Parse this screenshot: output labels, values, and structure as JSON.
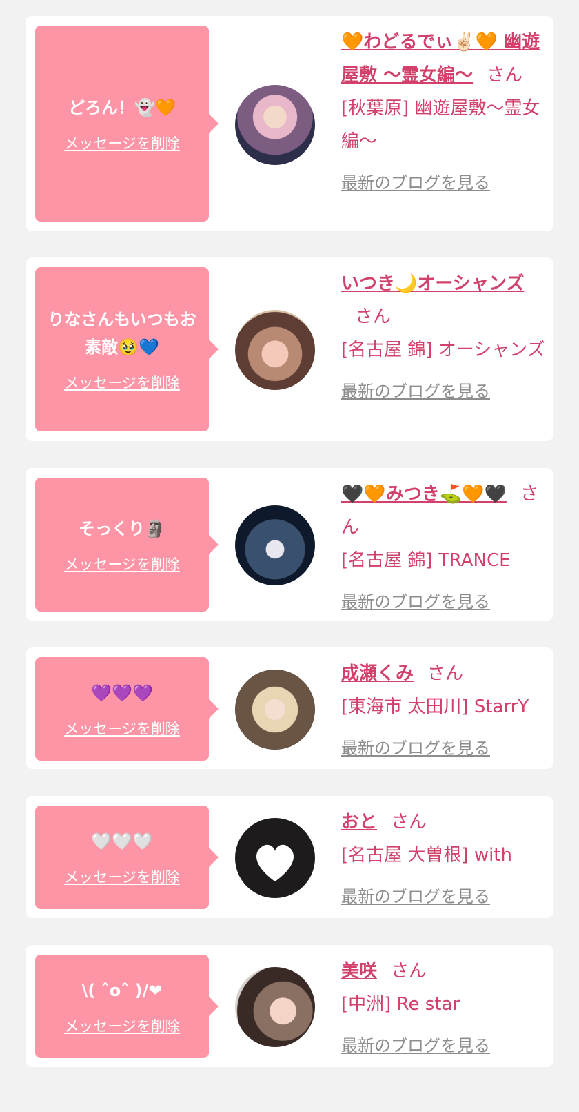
{
  "delete_label": "メッセージを削除",
  "blog_label": "最新のブログを見る",
  "san_label": "さん",
  "messages": [
    {
      "message": "どろん！👻🧡",
      "name": "🧡わどるでぃ✌🏻🧡 幽遊屋敷 〜霊女編〜",
      "shop": "[秋葉原] 幽遊屋敷〜霊女編〜"
    },
    {
      "message": "りなさんもいつもお素敵🥹💙",
      "name": "いつき🌙オーシャンズ",
      "shop": "[名古屋 錦] オーシャンズ"
    },
    {
      "message": "そっくり🗿",
      "name": "🖤🧡みつき⛳🧡🖤",
      "shop": "[名古屋 錦] TRANCE"
    },
    {
      "message": "💜💜💜",
      "name": "成瀬くみ",
      "shop": "[東海市 太田川] StarrY"
    },
    {
      "message": "🤍🤍🤍",
      "name": "おと",
      "shop": "[名古屋 大曽根] with"
    },
    {
      "message": "\\( ˆoˆ )/❤",
      "name": "美咲",
      "shop": "[中洲] Re star"
    }
  ]
}
